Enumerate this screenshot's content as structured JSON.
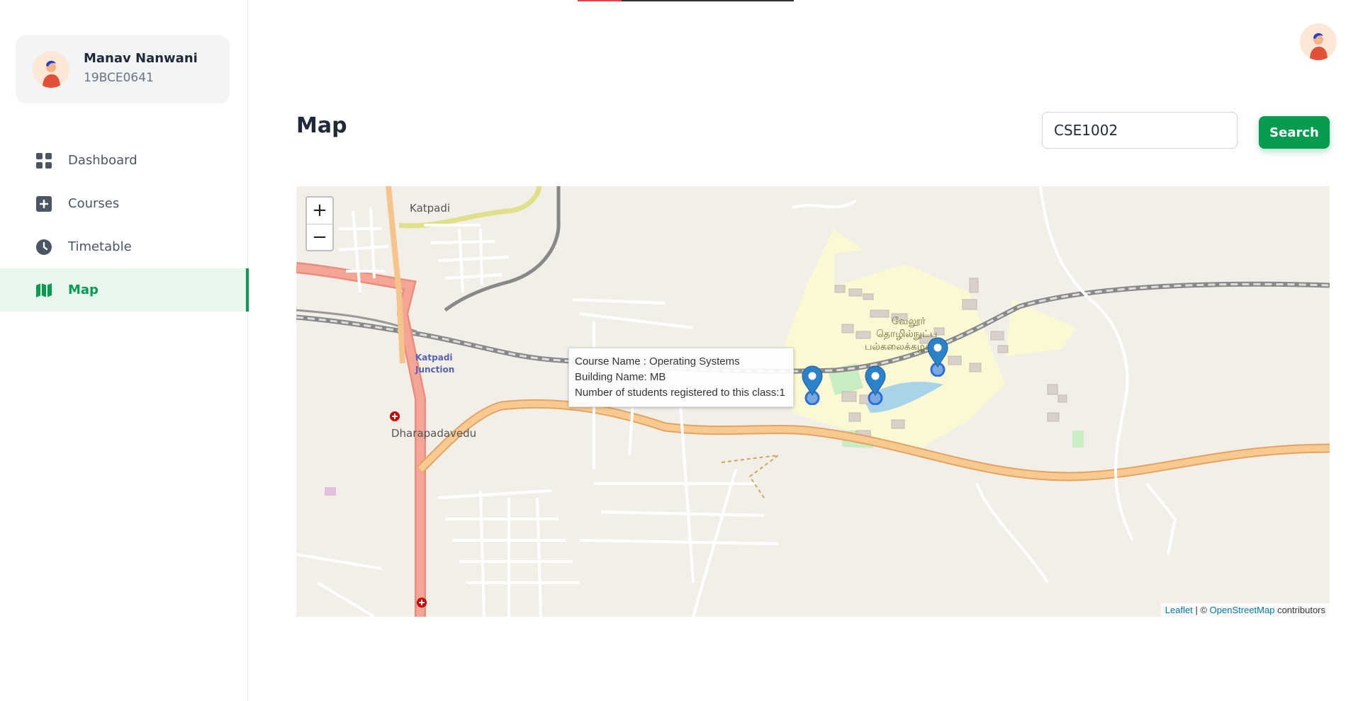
{
  "user": {
    "name": "Manav Nanwani",
    "id": "19BCE0641"
  },
  "nav": {
    "items": [
      {
        "label": "Dashboard",
        "icon": "grid-icon"
      },
      {
        "label": "Courses",
        "icon": "plus-square-icon"
      },
      {
        "label": "Timetable",
        "icon": "clock-icon"
      },
      {
        "label": "Map",
        "icon": "map-icon",
        "active": true
      }
    ]
  },
  "page": {
    "title": "Map"
  },
  "search": {
    "value": "CSE1002",
    "button": "Search"
  },
  "map": {
    "zoom_in": "+",
    "zoom_out": "−",
    "popup": {
      "course": "Course Name : Operating Systems",
      "building": "Building Name: MB",
      "students": "Number of students registered to this class:1"
    },
    "labels": {
      "katpadi": "Katpadi",
      "junction_1": "Katpadi",
      "junction_2": "Junction",
      "dharapadavedu": "Dharapadavedu",
      "tamil_1": "வேலூர்",
      "tamil_2": "தொழில்நுட்ப",
      "tamil_3": "பல்கலைக்கழகம்"
    },
    "attribution": {
      "leaflet": "Leaflet",
      "sep": "| ©",
      "osm": "OpenStreetMap",
      "suffix": "contributors"
    },
    "marker_count": 3
  },
  "colors": {
    "accent": "#059c4f",
    "accent_bg": "#e8f6ee",
    "marker": "#2b82cb"
  }
}
